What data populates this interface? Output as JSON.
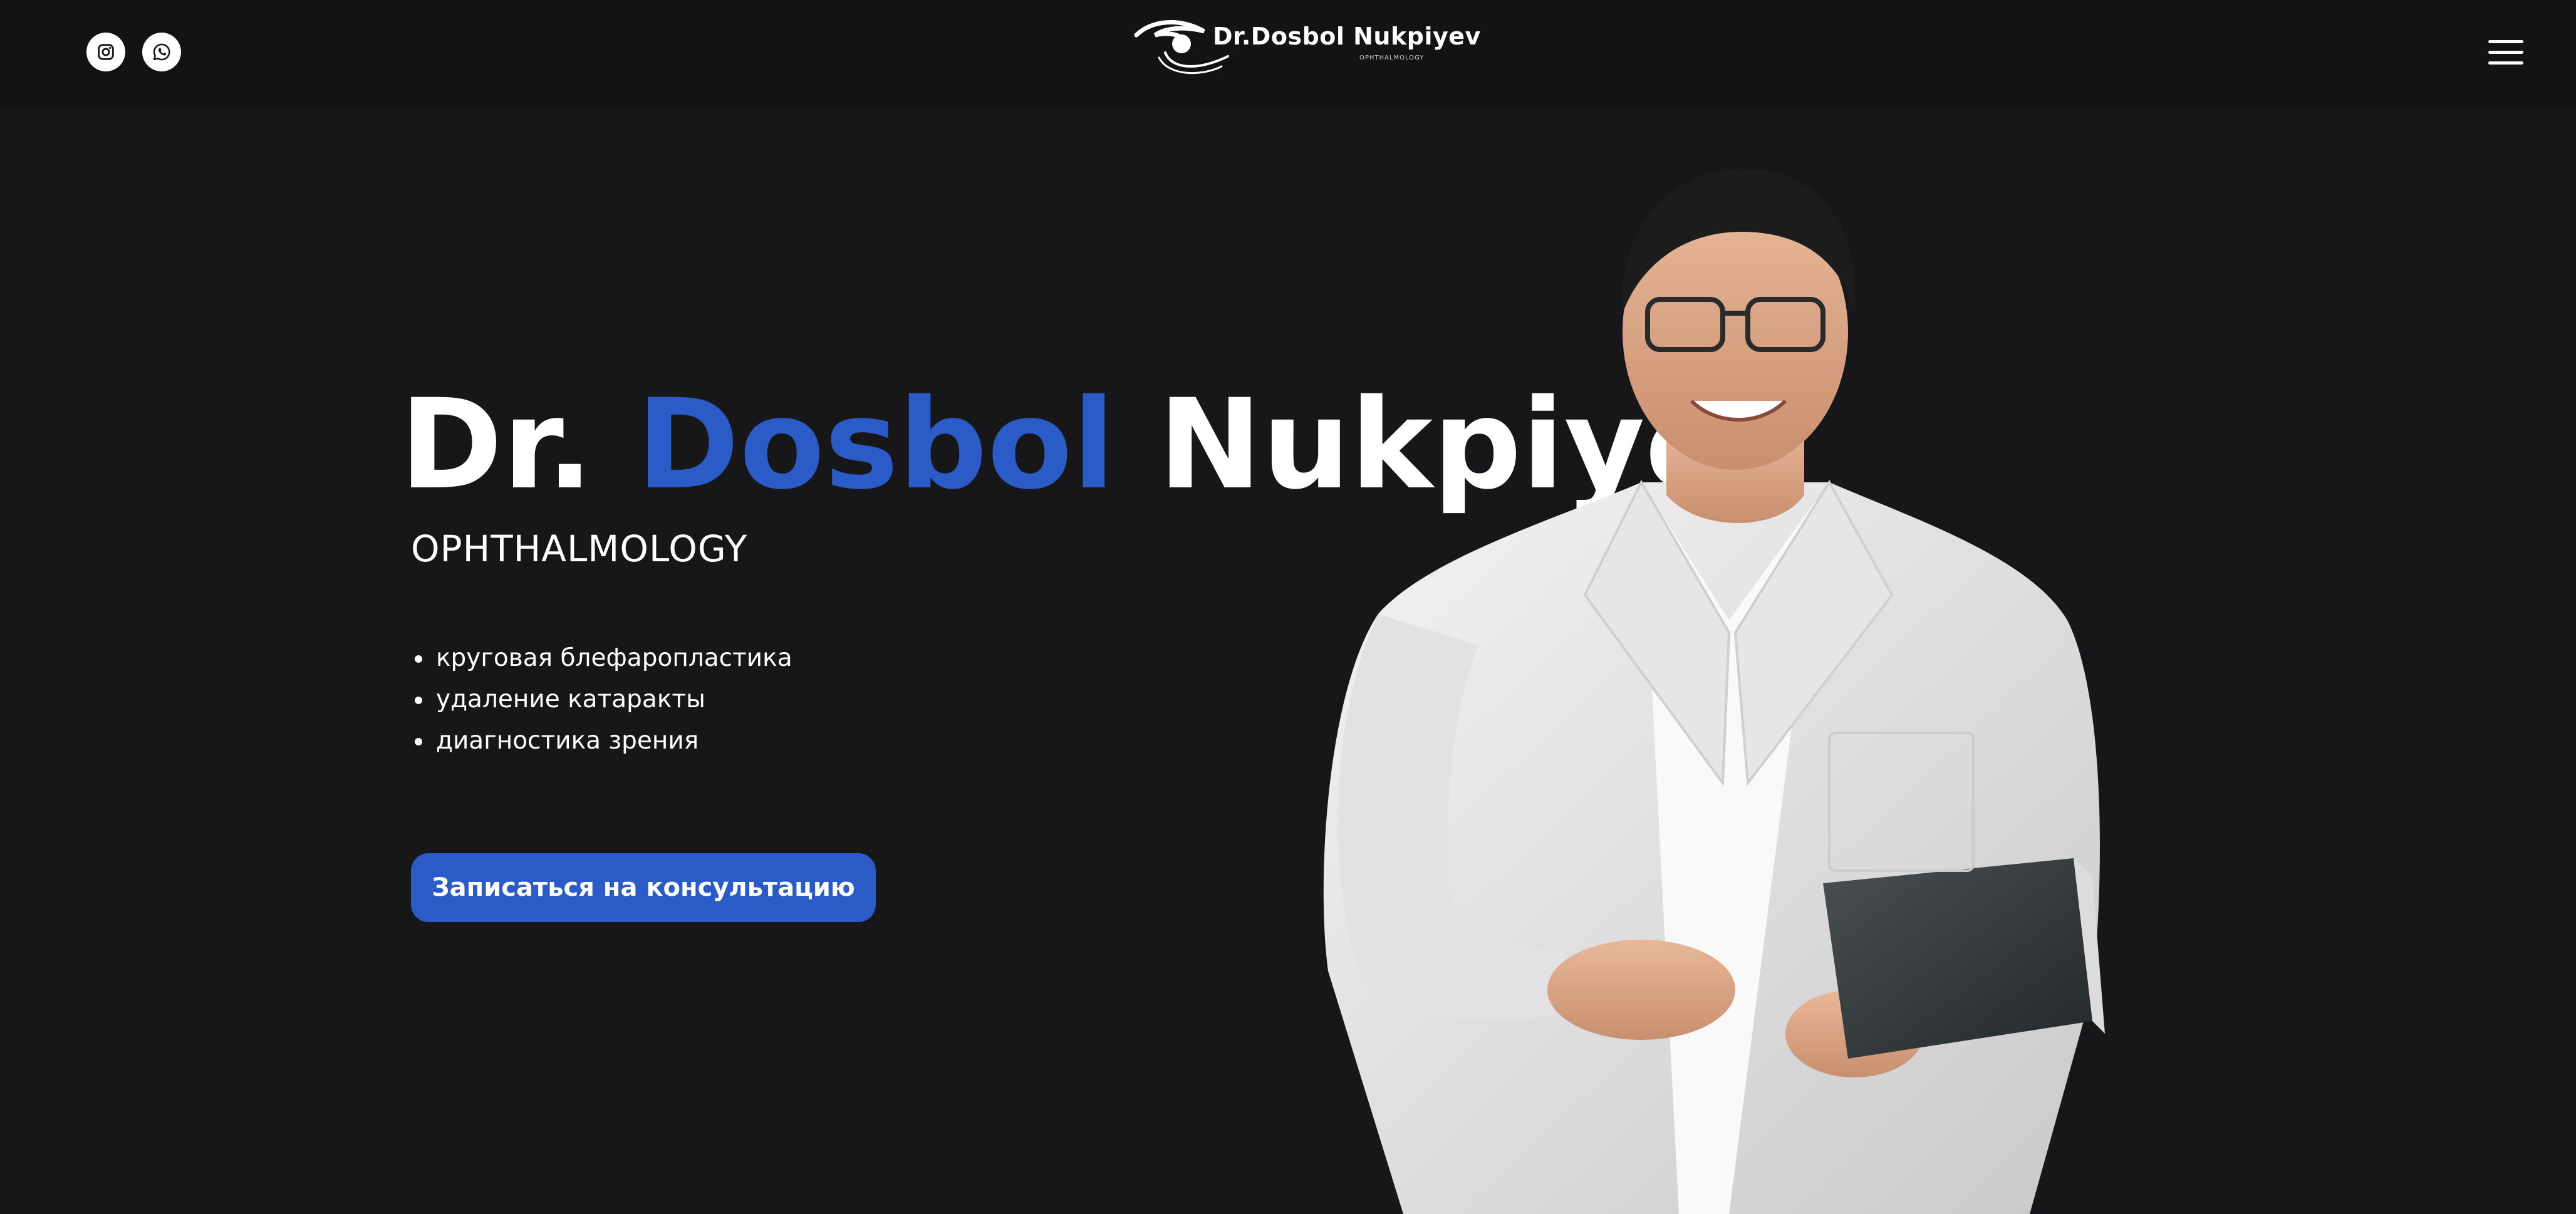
{
  "header": {
    "social": [
      {
        "name": "instagram",
        "icon": "instagram-icon"
      },
      {
        "name": "whatsapp",
        "icon": "whatsapp-icon"
      }
    ],
    "logo": {
      "name": "Dr.Dosbol Nukpiyev",
      "sub": "OPHTHALMOLOGY"
    },
    "menu_icon": "hamburger-menu-icon"
  },
  "hero": {
    "title_prefix": "Dr.",
    "title_accent": "Dosbol",
    "title_suffix": "Nukpiyev",
    "subtitle": "OPHTHALMOLOGY",
    "services": [
      "круговая блефаропластика",
      "удаление катаракты",
      "диагностика зрения"
    ],
    "cta_label": "Записаться на консультацию"
  },
  "colors": {
    "background": "#171719",
    "header_background": "#131315",
    "accent": "#2a5bc7",
    "text": "#ffffff"
  }
}
